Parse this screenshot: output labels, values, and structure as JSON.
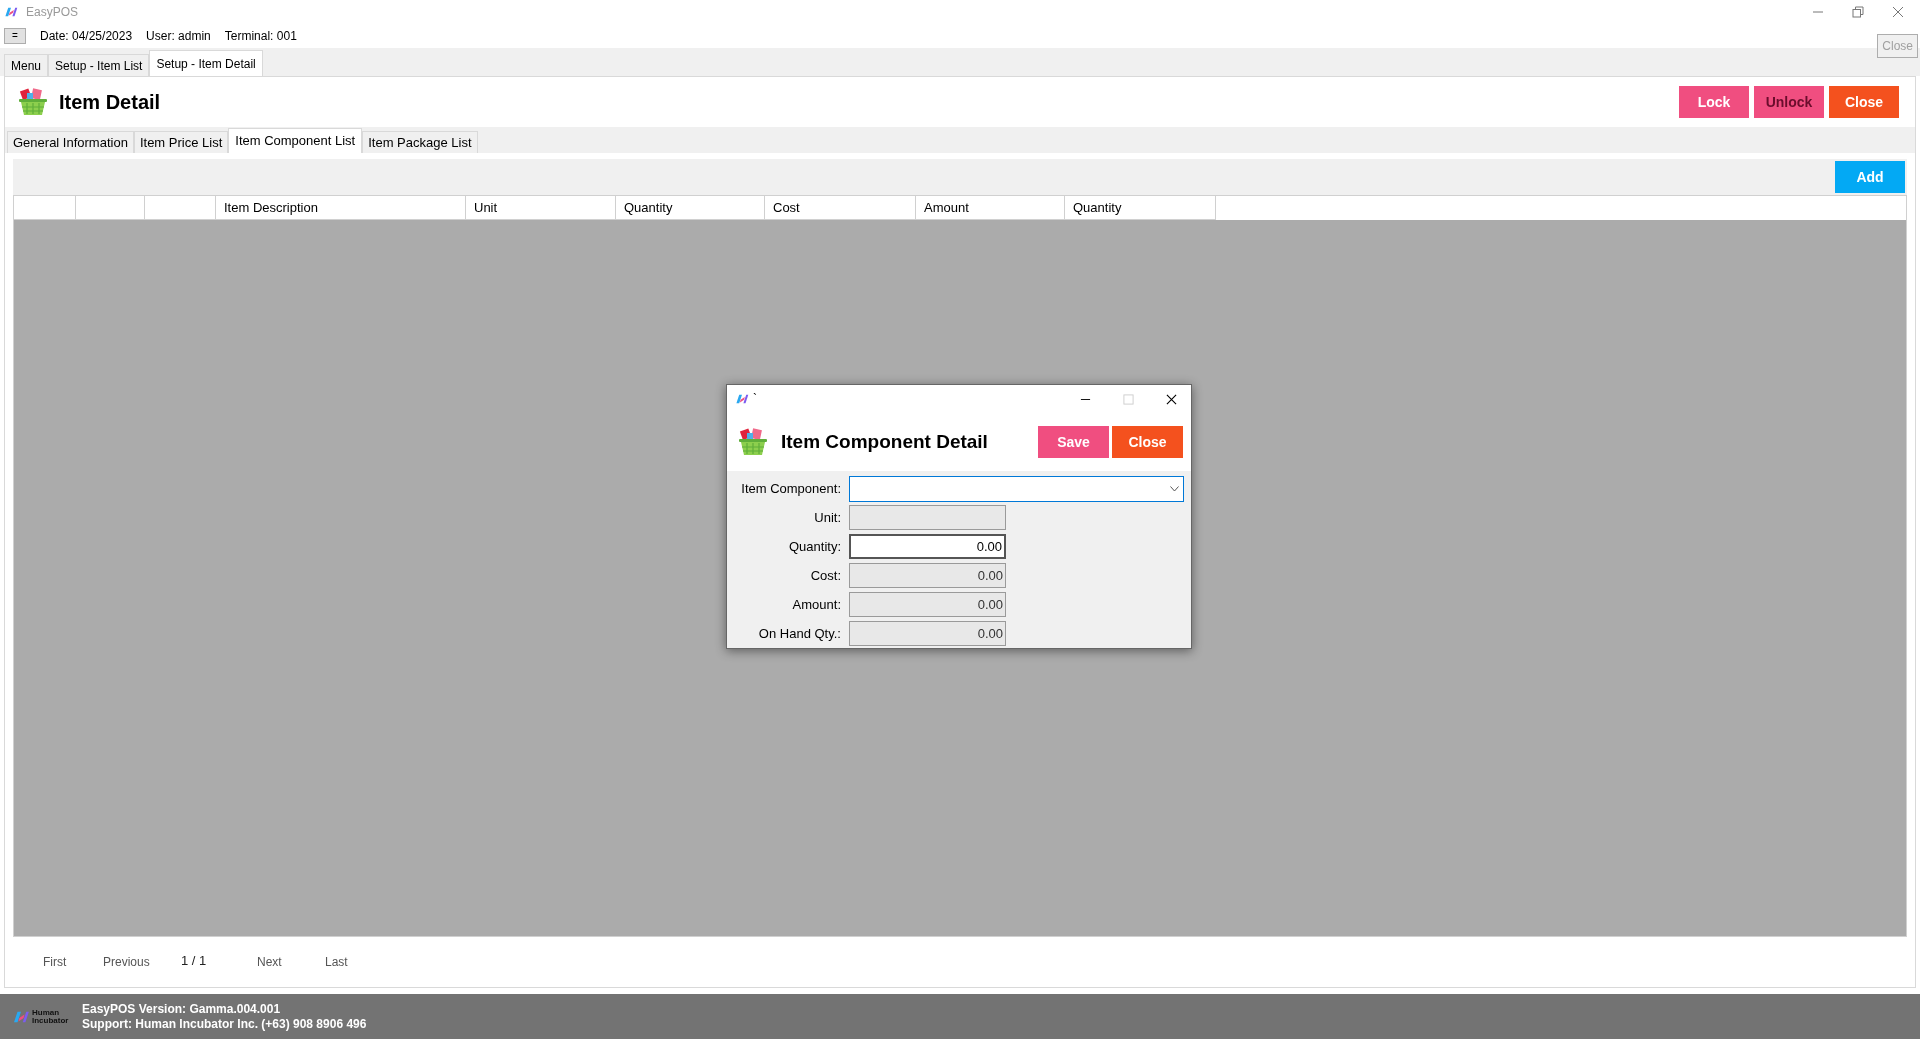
{
  "window": {
    "title": "EasyPOS"
  },
  "info_bar": {
    "menu_button": "=",
    "date": "Date: 04/25/2023",
    "user": "User: admin",
    "terminal": "Terminal: 001"
  },
  "close_all_button": "Close",
  "page_tabs": [
    {
      "label": "Menu",
      "selected": false
    },
    {
      "label": "Setup - Item List",
      "selected": false
    },
    {
      "label": "Setup - Item Detail",
      "selected": true
    }
  ],
  "page": {
    "title": "Item Detail",
    "buttons": [
      {
        "label": "Lock",
        "kind": "lock"
      },
      {
        "label": "Unlock",
        "kind": "unlock"
      },
      {
        "label": "Close",
        "kind": "close"
      }
    ]
  },
  "detail_tabs": [
    {
      "label": "General Information",
      "selected": false
    },
    {
      "label": "Item Price List",
      "selected": false
    },
    {
      "label": "Item Component List",
      "selected": true
    },
    {
      "label": "Item Package List",
      "selected": false
    }
  ],
  "add_button": "Add",
  "table": {
    "columns": [
      "Item Description",
      "Unit",
      "Quantity",
      "Cost",
      "Amount",
      "Quantity"
    ]
  },
  "pager": {
    "first": "First",
    "previous": "Previous",
    "page": "1 / 1",
    "next": "Next",
    "last": "Last"
  },
  "dialog": {
    "window_title": "`",
    "title": "Item Component Detail",
    "buttons": [
      {
        "label": "Save",
        "kind": "save"
      },
      {
        "label": "Close",
        "kind": "close"
      }
    ],
    "fields": [
      {
        "label": "Item Component:",
        "kind": "dropdown",
        "editable": true
      },
      {
        "label": "Unit:",
        "kind": "text",
        "editable": false
      },
      {
        "label": "Quantity:",
        "kind": "text",
        "value": "0.00",
        "editable": true
      },
      {
        "label": "Cost:",
        "kind": "text",
        "value": "0.00",
        "editable": false
      },
      {
        "label": "Amount:",
        "kind": "text",
        "value": "0.00",
        "editable": false
      },
      {
        "label": "On Hand Qty.:",
        "kind": "text",
        "value": "0.00",
        "editable": false
      }
    ]
  },
  "footer": {
    "logo_text": "Human Incubator",
    "version": "EasyPOS Version: Gamma.004.001",
    "support": "Support: Human Incubator Inc. (+63) 908 8906 496"
  }
}
